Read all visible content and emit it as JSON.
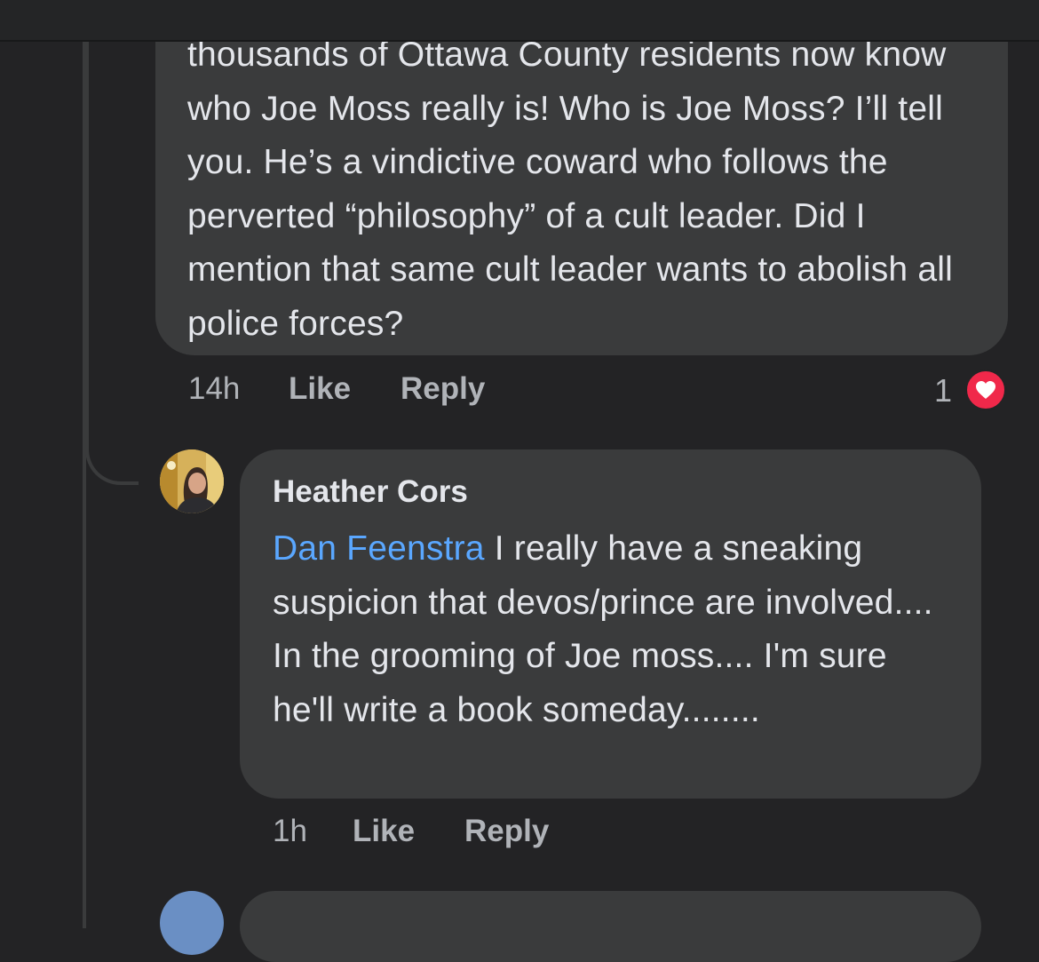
{
  "comment_1": {
    "text": "thousands of Ottawa County residents now know who Joe Moss really is! Who is Joe Moss? I’ll tell you. He’s a vindictive coward who follows the perverted “philosophy” of a cult leader. Did I mention that same cult leader wants to abolish all police forces?",
    "time": "14h",
    "like_label": "Like",
    "reply_label": "Reply",
    "reaction_count": "1",
    "reaction_icon": "heart-icon",
    "reaction_color": "#f0284a"
  },
  "comment_2": {
    "author": "Heather Cors",
    "mention": "Dan Feenstra",
    "text": " I really have a sneaking suspicion that devos/prince are involved.... In the grooming of Joe moss.... I'm sure he'll write a book someday........",
    "time": "1h",
    "like_label": "Like",
    "reply_label": "Reply"
  },
  "colors": {
    "background": "#232325",
    "bubble": "#3a3b3c",
    "mention": "#5aa7ff",
    "meta_text": "#b0b3b8"
  }
}
